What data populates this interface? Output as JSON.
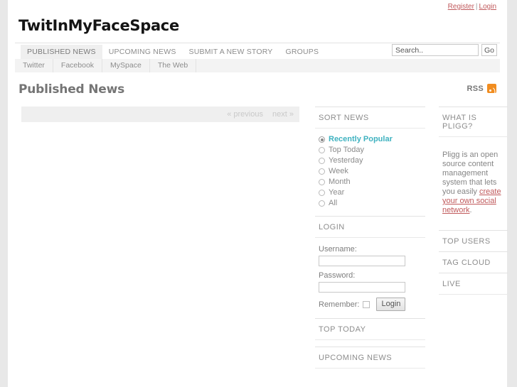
{
  "utility": {
    "register": "Register",
    "separator": "|",
    "login": "Login"
  },
  "site": {
    "title": "TwitInMyFaceSpace"
  },
  "nav": {
    "items": [
      {
        "label": "PUBLISHED NEWS",
        "active": true
      },
      {
        "label": "UPCOMING NEWS",
        "active": false
      },
      {
        "label": "SUBMIT A NEW STORY",
        "active": false
      },
      {
        "label": "GROUPS",
        "active": false
      }
    ]
  },
  "search": {
    "value": "",
    "placeholder": "Search..",
    "button": "Go"
  },
  "subnav": {
    "items": [
      {
        "label": "Twitter"
      },
      {
        "label": "Facebook"
      },
      {
        "label": "MySpace"
      },
      {
        "label": "The Web"
      }
    ]
  },
  "page": {
    "title": "Published News",
    "rss_label": "RSS"
  },
  "pagination": {
    "previous": "« previous",
    "next": "next »"
  },
  "sort_news": {
    "heading": "SORT NEWS",
    "options": [
      {
        "label": "Recently Popular",
        "selected": true
      },
      {
        "label": "Top Today",
        "selected": false
      },
      {
        "label": "Yesterday",
        "selected": false
      },
      {
        "label": "Week",
        "selected": false
      },
      {
        "label": "Month",
        "selected": false
      },
      {
        "label": "Year",
        "selected": false
      },
      {
        "label": "All",
        "selected": false
      }
    ]
  },
  "login_widget": {
    "heading": "LOGIN",
    "username_label": "Username:",
    "username_value": "",
    "password_label": "Password:",
    "password_value": "",
    "remember_label": "Remember:",
    "submit_label": "Login"
  },
  "top_today": {
    "heading": "TOP TODAY"
  },
  "upcoming_news": {
    "heading": "UPCOMING NEWS"
  },
  "what_is_pligg": {
    "heading": "WHAT IS PLIGG?",
    "text_before": "Pligg is an open source content management system that lets you easily ",
    "link_text": "create your own social network",
    "text_after": "."
  },
  "top_users": {
    "heading": "TOP USERS"
  },
  "tag_cloud": {
    "heading": "TAG CLOUD"
  },
  "live": {
    "heading": "LIVE"
  },
  "colors": {
    "accent_teal": "#3fb2c0",
    "link_red": "#c0595b",
    "rss_orange": "#f18d20",
    "page_bg": "#e8e8e8"
  }
}
